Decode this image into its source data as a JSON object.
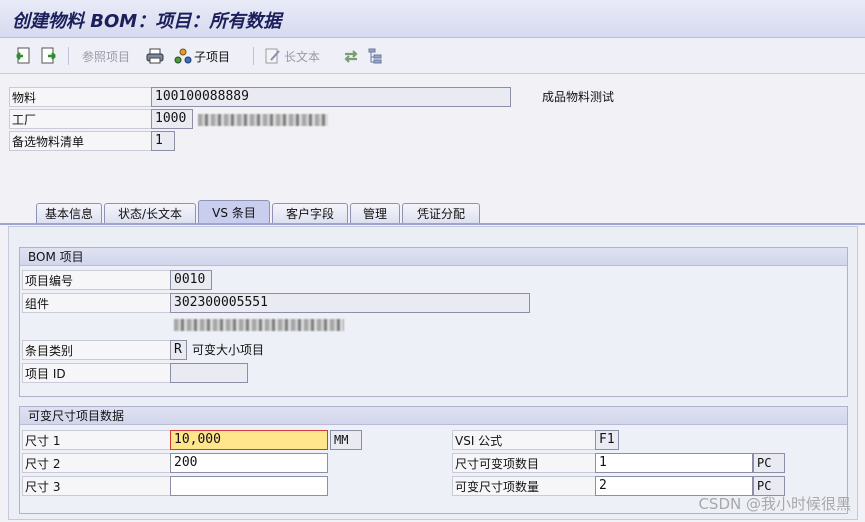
{
  "title": "创建物料 BOM：项目：所有数据",
  "toolbar": {
    "ref_item_label": "参照项目",
    "sub_item_label": "子项目",
    "long_text_label": "长文本"
  },
  "header": {
    "material_label": "物料",
    "material_value": "100100088889",
    "material_desc": "成品物料测试",
    "plant_label": "工厂",
    "plant_value": "1000",
    "alt_bom_label": "备选物料清单",
    "alt_bom_value": "1"
  },
  "tabs": [
    "基本信息",
    "状态/长文本",
    "VS 条目",
    "客户字段",
    "管理",
    "凭证分配"
  ],
  "bom_item": {
    "group_title": "BOM 项目",
    "item_no_label": "项目编号",
    "item_no_value": "0010",
    "component_label": "组件",
    "component_value": "302300005551",
    "item_cat_label": "条目类别",
    "item_cat_value": "R",
    "item_cat_desc": "可变大小项目",
    "item_id_label": "项目 ID",
    "item_id_value": ""
  },
  "vs_data": {
    "group_title": "可变尺寸项目数据",
    "size1_label": "尺寸 1",
    "size1_value": "10,000",
    "size1_unit": "MM",
    "size2_label": "尺寸 2",
    "size2_value": "200",
    "size3_label": "尺寸 3",
    "size3_value": "",
    "formula_label": "VSI 公式",
    "formula_value": "F1",
    "vs_count_label": "尺寸可变项数目",
    "vs_count_value": "1",
    "vs_count_unit": "PC",
    "vs_qty_label": "可变尺寸项数量",
    "vs_qty_value": "2",
    "vs_qty_unit": "PC"
  },
  "watermark": "CSDN @我小时候很黑",
  "colors": {
    "title": "#1b1f5a",
    "active_tab": "#c9cdee",
    "highlight_field": "#ffe58c"
  }
}
